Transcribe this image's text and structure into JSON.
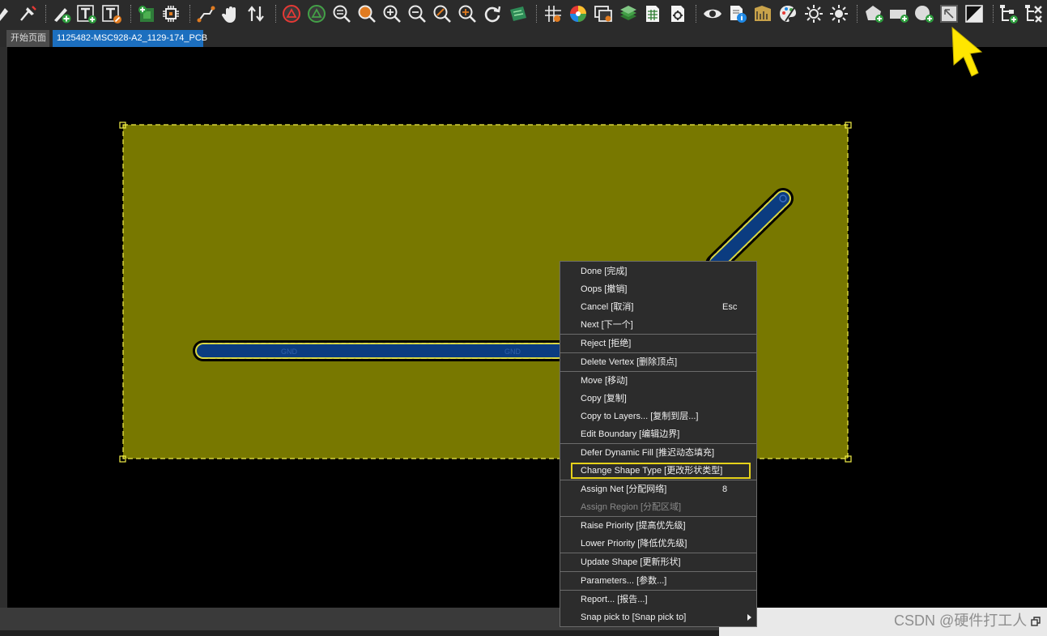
{
  "tabs": [
    {
      "label": "开始页面"
    },
    {
      "label": "1125482-MSC928-A2_1129-174_PCB"
    }
  ],
  "canvas": {
    "trace_labels": [
      "GND",
      "GND"
    ]
  },
  "context_menu": {
    "items": [
      {
        "label": "Done [完成]",
        "shortcut": "",
        "disabled": false
      },
      {
        "label": "Oops [撤销]",
        "shortcut": "",
        "disabled": false
      },
      {
        "label": "Cancel [取消]",
        "shortcut": "Esc",
        "disabled": false
      },
      {
        "label": "Next [下一个]",
        "shortcut": "",
        "disabled": false
      },
      {
        "label": "Reject [拒绝]",
        "shortcut": "",
        "disabled": false
      },
      {
        "label": "Delete Vertex [删除顶点]",
        "shortcut": "",
        "disabled": false
      },
      {
        "label": "Move [移动]",
        "shortcut": "",
        "disabled": false
      },
      {
        "label": "Copy [复制]",
        "shortcut": "",
        "disabled": false
      },
      {
        "label": "Copy to Layers... [复制到层...]",
        "shortcut": "",
        "disabled": false
      },
      {
        "label": "Edit Boundary [编辑边界]",
        "shortcut": "",
        "disabled": false
      },
      {
        "label": "Defer Dynamic Fill [推迟动态填充]",
        "shortcut": "",
        "disabled": false
      },
      {
        "label": "Change Shape Type [更改形状类型]",
        "shortcut": "",
        "disabled": false,
        "highlighted": true
      },
      {
        "label": "Assign Net [分配网络]",
        "shortcut": "8",
        "disabled": false
      },
      {
        "label": "Assign Region [分配区域]",
        "shortcut": "",
        "disabled": true
      },
      {
        "label": "Raise Priority [提高优先级]",
        "shortcut": "",
        "disabled": false
      },
      {
        "label": "Lower Priority [降低优先级]",
        "shortcut": "",
        "disabled": false
      },
      {
        "label": "Update Shape [更新形状]",
        "shortcut": "",
        "disabled": false
      },
      {
        "label": "Parameters... [参数...]",
        "shortcut": "",
        "disabled": false
      },
      {
        "label": "Report... [报告...]",
        "shortcut": "",
        "disabled": false
      },
      {
        "label": "Snap pick to [Snap pick to]",
        "shortcut": "",
        "disabled": false,
        "submenu": true
      }
    ]
  },
  "watermark": "CSDN @硬件打工人",
  "colors": {
    "shape_fill": "#787800",
    "trace_fill": "#0b3c80",
    "highlight": "#e6d21a",
    "tab_active": "#1c6fbf"
  },
  "toolbar": {
    "icons": [
      "select-icon",
      "pin-icon",
      "draw-add-icon",
      "text-add-icon",
      "text-edit-icon",
      "pcb-add-icon",
      "chip-icon",
      "route-icon",
      "hand-pan-icon",
      "swap-icon",
      "drc-red-icon",
      "drc-green-icon",
      "zoom-fit-icon",
      "zoom-area-icon",
      "zoom-in-icon",
      "zoom-out-icon",
      "zoom-prev-icon",
      "zoom-select-icon",
      "refresh-icon",
      "board-icon",
      "grid-icon",
      "color-wheel-icon",
      "window-icon",
      "layers-icon",
      "spreadsheet-icon",
      "document-settings-icon",
      "visibility-eye-icon",
      "info-icon",
      "measure-icon",
      "palette-icon",
      "sun-icon",
      "sun-alt-icon",
      "add-polygon-icon",
      "add-rectangle-icon",
      "add-circle-icon",
      "shape-select-icon",
      "shape-split-icon",
      "tree-add-icon",
      "tree-remove-icon"
    ]
  }
}
